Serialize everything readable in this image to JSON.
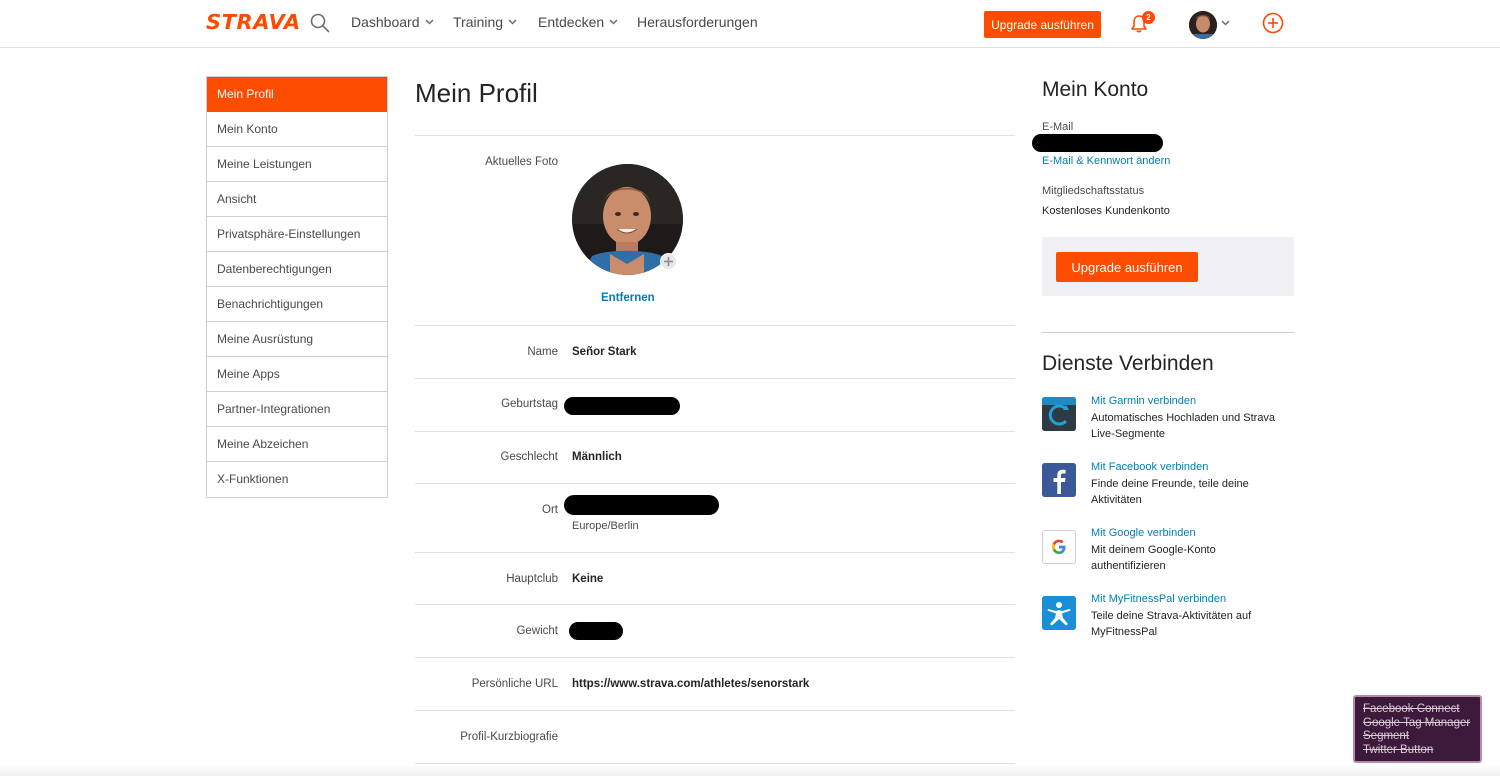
{
  "nav": {
    "logo": "STRAVA",
    "items": [
      {
        "label": "Dashboard",
        "has_dropdown": true
      },
      {
        "label": "Training",
        "has_dropdown": true
      },
      {
        "label": "Entdecken",
        "has_dropdown": true
      },
      {
        "label": "Herausforderungen",
        "has_dropdown": false
      }
    ],
    "upgrade_label": "Upgrade ausführen",
    "notification_count": "2",
    "icons": [
      "search-icon",
      "bell-icon",
      "avatar",
      "chevron-down-icon",
      "plus-circle-icon"
    ],
    "accent_color": "#fc4c02"
  },
  "sidebar": {
    "items": [
      {
        "label": "Mein Profil",
        "active": true
      },
      {
        "label": "Mein Konto",
        "active": false
      },
      {
        "label": "Meine Leistungen",
        "active": false
      },
      {
        "label": "Ansicht",
        "active": false
      },
      {
        "label": "Privatsphäre-Einstellungen",
        "active": false
      },
      {
        "label": "Datenberechtigungen",
        "active": false
      },
      {
        "label": "Benachrichtigungen",
        "active": false
      },
      {
        "label": "Meine Ausrüstung",
        "active": false
      },
      {
        "label": "Meine Apps",
        "active": false
      },
      {
        "label": "Partner-Integrationen",
        "active": false
      },
      {
        "label": "Meine Abzeichen",
        "active": false
      },
      {
        "label": "X-Funktionen",
        "active": false
      }
    ]
  },
  "profile": {
    "title": "Mein Profil",
    "photo_label": "Aktuelles Foto",
    "remove_label": "Entfernen",
    "name_label": "Name",
    "name_value": "Señor Stark",
    "birthday_label": "Geburtstag",
    "gender_label": "Geschlecht",
    "gender_value": "Männlich",
    "location_label": "Ort",
    "timezone_value": "Europe/Berlin",
    "club_label": "Hauptclub",
    "club_value": "Keine",
    "weight_label": "Gewicht",
    "url_label": "Persönliche URL",
    "url_value": "https://www.strava.com/athletes/senorstark",
    "bio_label": "Profil-Kurzbiografie"
  },
  "account": {
    "title": "Mein Konto",
    "email_label": "E-Mail",
    "change_link": "E-Mail & Kennwort ändern",
    "membership_label": "Mitgliedschaftsstatus",
    "membership_value": "Kostenloses Kundenkonto",
    "upgrade_label": "Upgrade ausführen"
  },
  "services": {
    "title": "Dienste Verbinden",
    "items": [
      {
        "link": "Mit Garmin verbinden",
        "desc_line1": "Automatisches Hochladen und Strava",
        "desc_line2": "Live-Segmente",
        "icon": "garmin-icon",
        "color": "#2e3a44"
      },
      {
        "link": "Mit Facebook verbinden",
        "desc_line1": "Finde deine Freunde, teile deine",
        "desc_line2": "Aktivitäten",
        "icon": "facebook-icon",
        "color": "#3b5998"
      },
      {
        "link": "Mit Google verbinden",
        "desc_line1": "Mit deinem Google-Konto",
        "desc_line2": "authentifizieren",
        "icon": "google-icon",
        "color": "#ffffff"
      },
      {
        "link": "Mit MyFitnessPal verbinden",
        "desc_line1": "Teile deine Strava-Aktivitäten auf",
        "desc_line2": "MyFitnessPal",
        "icon": "myfitnesspal-icon",
        "color": "#1a8fd6"
      }
    ]
  },
  "debug": {
    "items": [
      "Facebook Connect",
      "Google Tag Manager",
      "Segment",
      "Twitter Button"
    ]
  }
}
